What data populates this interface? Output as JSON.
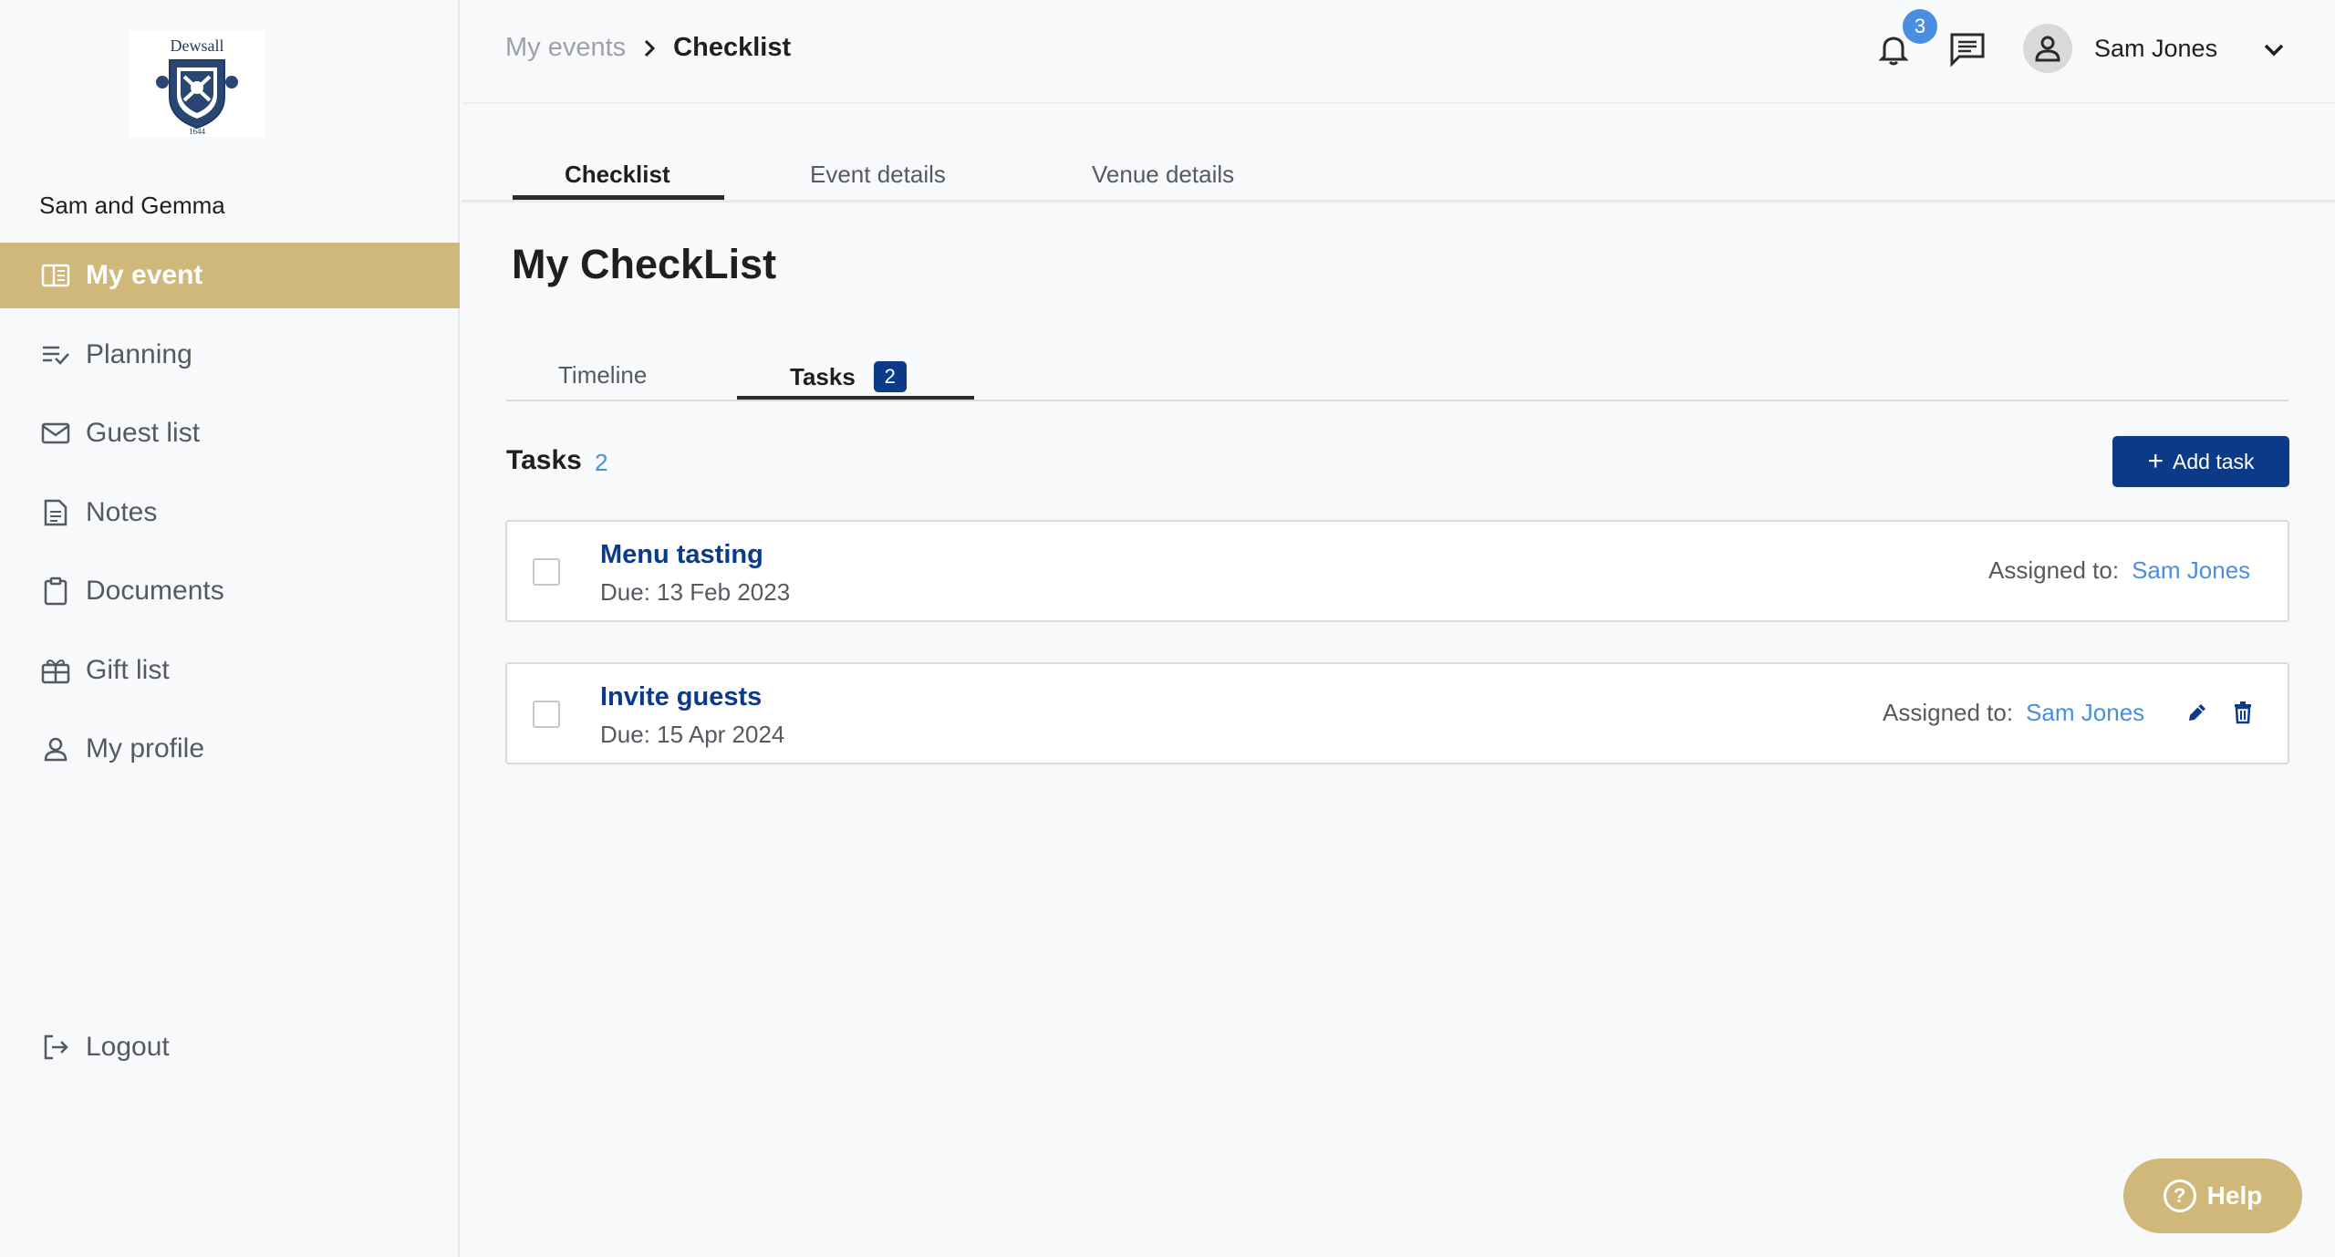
{
  "sidebar": {
    "logo": {
      "icon": "dewsall-crest-logo",
      "text": "Dewsall",
      "year": "1644"
    },
    "event_name": "Sam and Gemma",
    "items": [
      {
        "label": "My event",
        "icon": "event-book-icon",
        "active": true
      },
      {
        "label": "Planning",
        "icon": "checklist-icon",
        "active": false
      },
      {
        "label": "Guest list",
        "icon": "envelope-icon",
        "active": false
      },
      {
        "label": "Notes",
        "icon": "notes-icon",
        "active": false
      },
      {
        "label": "Documents",
        "icon": "clipboard-icon",
        "active": false
      },
      {
        "label": "Gift list",
        "icon": "gift-icon",
        "active": false
      },
      {
        "label": "My profile",
        "icon": "person-icon",
        "active": false
      }
    ],
    "logout_label": "Logout"
  },
  "header": {
    "breadcrumb": {
      "parent": "My events",
      "current": "Checklist"
    },
    "notifications_count": "3",
    "user_name": "Sam Jones"
  },
  "main_tabs": [
    {
      "label": "Checklist",
      "active": true
    },
    {
      "label": "Event details",
      "active": false
    },
    {
      "label": "Venue details",
      "active": false
    }
  ],
  "page_title": "My CheckList",
  "sub_tabs": {
    "timeline_label": "Timeline",
    "tasks_label": "Tasks",
    "tasks_count": "2"
  },
  "tasks_section": {
    "title": "Tasks",
    "count": "2",
    "add_button_label": "Add task"
  },
  "tasks": [
    {
      "name": "Menu tasting",
      "due": "Due: 13 Feb 2023",
      "assigned_label": "Assigned to:",
      "assignee": "Sam Jones",
      "checked": false
    },
    {
      "name": "Invite guests",
      "due": "Due: 15 Apr 2024",
      "assigned_label": "Assigned to:",
      "assignee": "Sam Jones",
      "checked": false
    }
  ],
  "help_label": "Help",
  "colors": {
    "accent_gold": "#cfb87a",
    "primary_navy": "#0b3a88",
    "link_blue": "#4a8ee0",
    "badge_blue": "#4a8ee0"
  }
}
